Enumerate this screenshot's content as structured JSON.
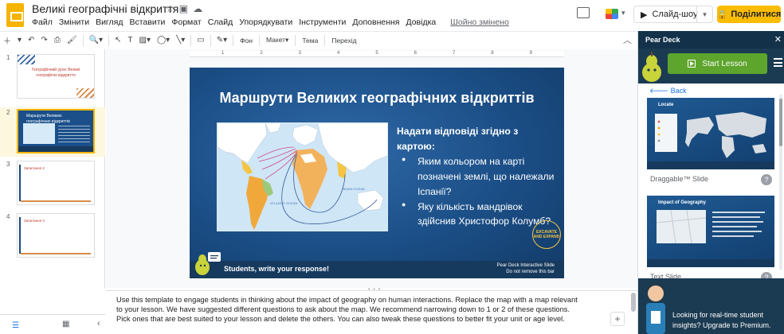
{
  "app": {
    "doc_title": "Великі географічні відкриття",
    "menu": [
      "Файл",
      "Змінити",
      "Вигляд",
      "Вставити",
      "Формат",
      "Слайд",
      "Упорядкувати",
      "Інструменти",
      "Доповнення",
      "Довідка"
    ],
    "saved_status": "Шойно змінено",
    "slideshow_label": "Слайд-шоу",
    "share_label": "Поділитися"
  },
  "toolbar": {
    "background_label": "Фон",
    "layout_label": "Макет",
    "theme_label": "Тема",
    "transition_label": "Перехід"
  },
  "ruler": {
    "ticks": [
      "1",
      "2",
      "3",
      "4",
      "5",
      "6",
      "7",
      "8",
      "9"
    ]
  },
  "filmstrip": {
    "slides": [
      {
        "number": "1",
        "text": "Географічний урок: Великі географічні відкриття"
      },
      {
        "number": "2",
        "text": "Маршрути Великих географічних відкриттів"
      },
      {
        "number": "3",
        "text": "Запитання 2"
      },
      {
        "number": "4",
        "text": "Запитання 3"
      }
    ]
  },
  "slide": {
    "title": "Маршрути Великих географічних відкриттів",
    "lead": "Надати відповіді згідно з картою:",
    "bullets": [
      "Яким кольором на карті позначені землі, що належали Іспанії?",
      "Яку кількість мандрівок здійснив Христофор Колумб?"
    ],
    "map_labels": {
      "indian_ocean": "INDIAN OCEAN",
      "atlantic_ocean": "ATLANTIC OCEAN"
    },
    "footer_text": "Students, write your response!",
    "footer_right_line1": "Pear Deck Interactive Slide",
    "footer_right_line2": "Do not remove this bar",
    "stamp_text": "EXCAVATE AND EXPAND"
  },
  "notes": {
    "text": "Use this template to engage students in thinking about the impact of geography on human interactions. Replace the map with a map relevant to your lesson. We have suggested different questions to ask about the map. We recommend narrowing down to 1 or 2 of these questions. Pick ones that are best suited to your lesson and delete the others.  You can also tweak these questions to better fit your unit or age level."
  },
  "pear_deck": {
    "title": "Pear Deck",
    "start_label": "Start Lesson",
    "back_label": "Back",
    "cards": [
      {
        "title": "Locate",
        "label": "Draggable™ Slide"
      },
      {
        "title": "Impact of Geography",
        "label": "Text Slide"
      }
    ],
    "promo_text_1": "Looking for real-time student",
    "promo_text_2": "insights? Upgrade to Premium."
  },
  "colors": {
    "brand_yellow": "#fbbc04",
    "slide_blue": "#1b4e86",
    "pear_green": "#5da52c",
    "pear_navy": "#1b3b52"
  }
}
